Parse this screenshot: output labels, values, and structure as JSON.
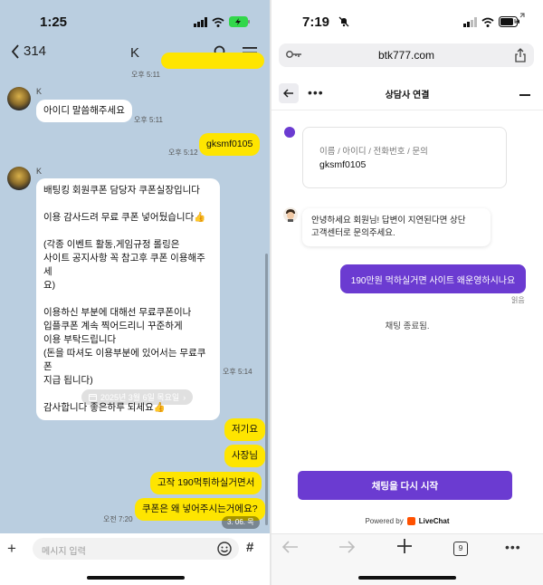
{
  "left": {
    "status": {
      "time": "1:25",
      "battery": "low-battery-charging"
    },
    "header": {
      "back_count": "314",
      "title": "K"
    },
    "messages": {
      "top_time": "오후 5:11",
      "k1_sender": "K",
      "k1_text": "아이디 말씀해주세요",
      "k1_time": "오후 5:11",
      "me1_text": "gksmf0105",
      "me1_time": "오후 5:12",
      "k2_sender": "K",
      "k2_text": "배팅킹 회원쿠폰 담당자 쿠폰실장입니다\n\n이용 감사드려 무료 쿠폰 넣어뒀습니다👍\n\n(각종 이벤트 활동,게임규정 롤링은\n사이트 공지사항 꼭 참고후 쿠폰 이용해주세\n요)\n\n이용하신 부분에 대해선 무료쿠폰이나\n입플쿠폰 계속 찍어드리니 꾸준하게\n이용 부탁드립니다\n(돈을 따셔도 이용부분에 있어서는 무료쿠폰\n지급 됩니다)\n\n감사합니다 좋은하루 되세요👍",
      "k2_time": "오후 5:14",
      "date_chip": "2025년 3월 6일 목요일",
      "me2_text": "저기요",
      "me3_text": "사장님",
      "me4_text": "고작 190먹튀하실거면서",
      "me5_text": "쿠폰은 왜 넣어주시는거에요?",
      "me5_time": "오전 7:20",
      "scroll_date": "3. 06. 목"
    },
    "input": {
      "placeholder": "메시지 입력"
    }
  },
  "right": {
    "status": {
      "time": "7:19"
    },
    "url": "btk777.com",
    "chat_header": {
      "more": "•••",
      "title": "상담사 연결"
    },
    "form": {
      "label": "이름 / 아이디 / 전화번호 / 문의",
      "value": "gksmf0105"
    },
    "agent_message": "안녕하세요 회원님! 답변이 지연된다면 상단\n고객센터로 문의주세요.",
    "user_message": "190만원 먹하실거면 사이트 왜운영하시나요",
    "read_label": "읽음",
    "ended_label": "채팅 종료됨.",
    "restart_button": "채팅을 다시 시작",
    "powered_by": "Powered by",
    "brand": "LiveChat",
    "tab_count": "9",
    "more": "•••"
  },
  "colors": {
    "kakao_bg": "#bacee0",
    "kakao_yellow": "#fee500",
    "livechat_purple": "#6b3bd1"
  }
}
